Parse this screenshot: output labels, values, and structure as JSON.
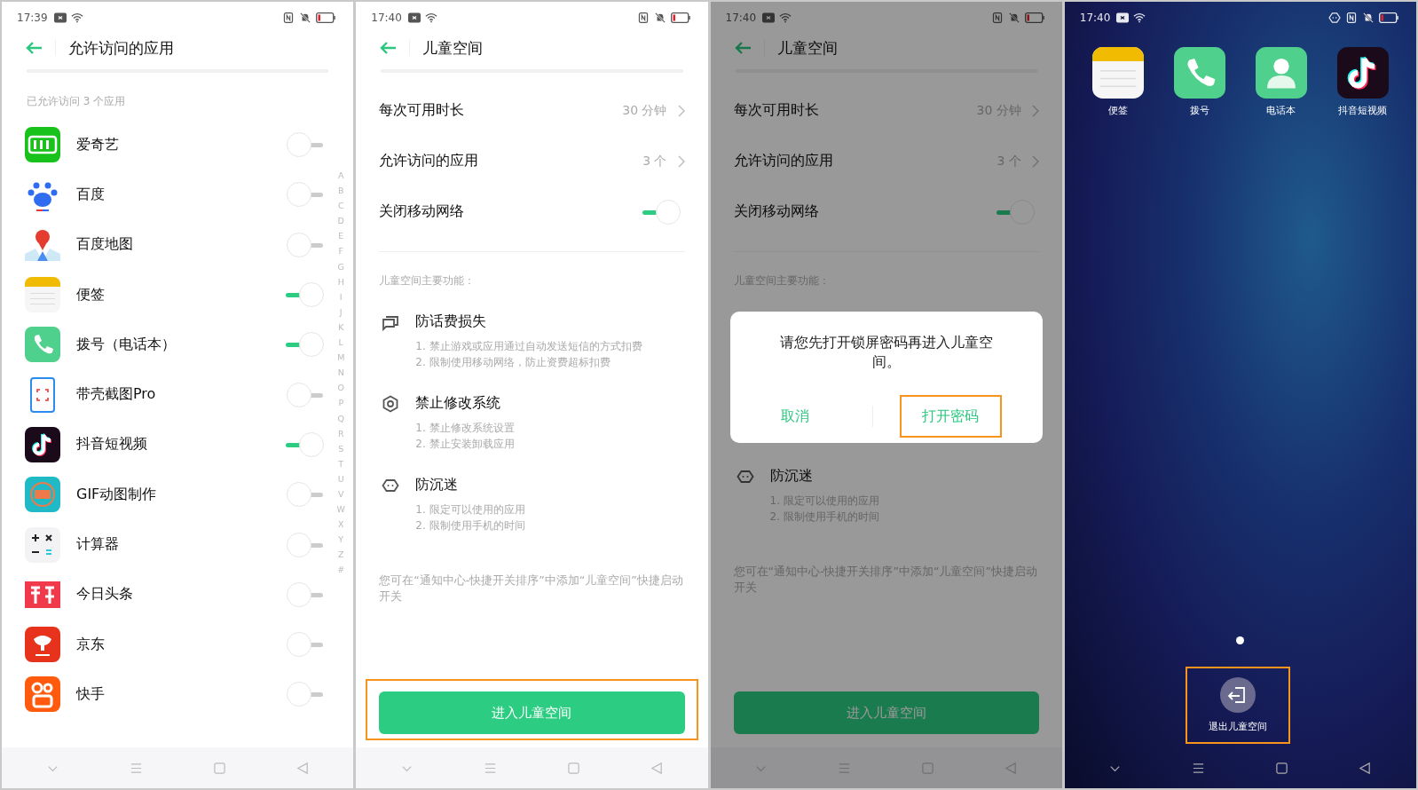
{
  "phones": [
    {
      "kind": "app_list",
      "status": {
        "time": "17:39"
      },
      "title": "允许访问的应用",
      "subtitle": "已允许访问 3 个应用",
      "apps": [
        {
          "name": "爱奇艺",
          "kind": "iqiyi",
          "on": false
        },
        {
          "name": "百度",
          "kind": "paw",
          "on": false
        },
        {
          "name": "百度地图",
          "kind": "map",
          "on": false
        },
        {
          "name": "便签",
          "kind": "notes",
          "on": true
        },
        {
          "name": "拨号（电话本）",
          "kind": "phone",
          "on": true
        },
        {
          "name": "带壳截图Pro",
          "kind": "screenshot",
          "on": false
        },
        {
          "name": "抖音短视频",
          "kind": "tiktok",
          "on": true
        },
        {
          "name": "GIF动图制作",
          "kind": "gif",
          "on": false
        },
        {
          "name": "计算器",
          "kind": "calculator",
          "on": false
        },
        {
          "name": "今日头条",
          "kind": "news",
          "on": false
        },
        {
          "name": "京东",
          "kind": "dog",
          "on": false
        },
        {
          "name": "快手",
          "kind": "camera",
          "on": false
        }
      ],
      "index": [
        "A",
        "B",
        "C",
        "D",
        "E",
        "F",
        "G",
        "H",
        "I",
        "J",
        "K",
        "L",
        "M",
        "N",
        "O",
        "P",
        "Q",
        "R",
        "S",
        "T",
        "U",
        "V",
        "W",
        "X",
        "Y",
        "Z",
        "#"
      ]
    },
    {
      "kind": "settings",
      "status": {
        "time": "17:40"
      },
      "title": "儿童空间",
      "rows": [
        {
          "kind": "link",
          "label": "每次可用时长",
          "value": "30 分钟"
        },
        {
          "kind": "link",
          "label": "允许访问的应用",
          "value": "3 个"
        },
        {
          "kind": "switch",
          "label": "关闭移动网络",
          "on": true
        }
      ],
      "section": "儿童空间主要功能：",
      "features": [
        {
          "kind": "message",
          "title": "防话费损失",
          "lines": [
            "1. 禁止游戏或应用通过自动发送短信的方式扣费",
            "2. 限制使用移动网络，防止资费超标扣费"
          ]
        },
        {
          "kind": "settings",
          "title": "禁止修改系统",
          "lines": [
            "1. 禁止修改系统设置",
            "2. 禁止安装卸载应用"
          ]
        },
        {
          "kind": "face",
          "title": "防沉迷",
          "lines": [
            "1. 限定可以使用的应用",
            "2. 限制使用手机的时间"
          ]
        }
      ],
      "note": "您可在“通知中心-快捷开关排序”中添加“儿童空间”快捷启动开关",
      "button": {
        "label": "进入儿童空间",
        "highlighted": true
      }
    },
    {
      "kind": "settings",
      "status": {
        "time": "17:40"
      },
      "title": "儿童空间",
      "rows": [
        {
          "kind": "link",
          "label": "每次可用时长",
          "value": "30 分钟"
        },
        {
          "kind": "link",
          "label": "允许访问的应用",
          "value": "3 个"
        },
        {
          "kind": "switch",
          "label": "关闭移动网络",
          "on": true
        }
      ],
      "section": "儿童空间主要功能：",
      "features": [
        {
          "kind": "face",
          "title": "防沉迷",
          "lines": [
            "1. 限定可以使用的应用",
            "2. 限制使用手机的时间"
          ]
        }
      ],
      "note": "您可在“通知中心-快捷开关排序”中添加“儿童空间”快捷启动开关",
      "button": {
        "label": "进入儿童空间",
        "highlighted": false
      },
      "dialog": {
        "message": "请您先打开锁屏密码再进入儿童空间。",
        "buttons": [
          {
            "label": "取消",
            "highlighted": false
          },
          {
            "label": "打开密码",
            "highlighted": true
          }
        ]
      }
    },
    {
      "kind": "home",
      "status": {
        "time": "17:40",
        "child_mode": true
      },
      "apps": [
        {
          "name": "便签",
          "kind": "notes"
        },
        {
          "name": "拨号",
          "kind": "phone"
        },
        {
          "name": "电话本",
          "kind": "contacts"
        },
        {
          "name": "抖音短视频",
          "kind": "tiktok"
        }
      ],
      "exit_button": {
        "label": "退出儿童空间",
        "highlighted": true
      }
    }
  ]
}
